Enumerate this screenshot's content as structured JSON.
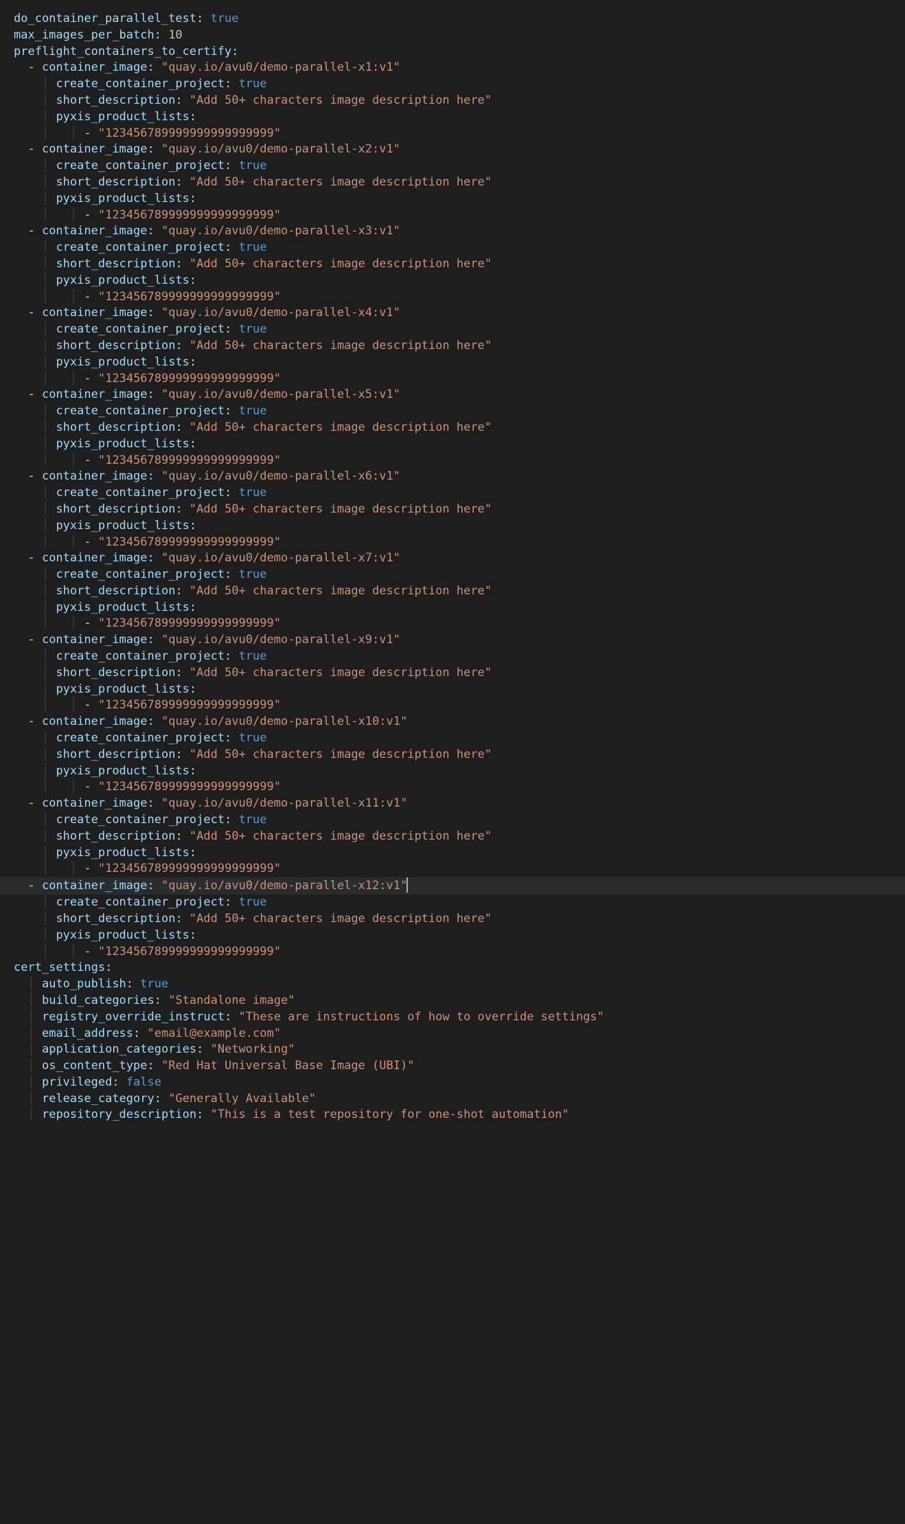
{
  "top": {
    "do_container_parallel_test_key": "do_container_parallel_test",
    "do_container_parallel_test_val": "true",
    "max_images_per_batch_key": "max_images_per_batch",
    "max_images_per_batch_val": "10",
    "preflight_key": "preflight_containers_to_certify"
  },
  "entries": [
    {
      "image": "\"quay.io/avu0/demo-parallel-x1:v1\"",
      "ccp": "true",
      "sd": "\"Add 50+ characters image description here\"",
      "ppl": "\"123456789999999999999999\""
    },
    {
      "image": "\"quay.io/avu0/demo-parallel-x2:v1\"",
      "ccp": "true",
      "sd": "\"Add 50+ characters image description here\"",
      "ppl": "\"123456789999999999999999\""
    },
    {
      "image": "\"quay.io/avu0/demo-parallel-x3:v1\"",
      "ccp": "true",
      "sd": "\"Add 50+ characters image description here\"",
      "ppl": "\"123456789999999999999999\""
    },
    {
      "image": "\"quay.io/avu0/demo-parallel-x4:v1\"",
      "ccp": "true",
      "sd": "\"Add 50+ characters image description here\"",
      "ppl": "\"123456789999999999999999\""
    },
    {
      "image": "\"quay.io/avu0/demo-parallel-x5:v1\"",
      "ccp": "true",
      "sd": "\"Add 50+ characters image description here\"",
      "ppl": "\"123456789999999999999999\""
    },
    {
      "image": "\"quay.io/avu0/demo-parallel-x6:v1\"",
      "ccp": "true",
      "sd": "\"Add 50+ characters image description here\"",
      "ppl": "\"123456789999999999999999\""
    },
    {
      "image": "\"quay.io/avu0/demo-parallel-x7:v1\"",
      "ccp": "true",
      "sd": "\"Add 50+ characters image description here\"",
      "ppl": "\"123456789999999999999999\""
    },
    {
      "image": "\"quay.io/avu0/demo-parallel-x9:v1\"",
      "ccp": "true",
      "sd": "\"Add 50+ characters image description here\"",
      "ppl": "\"123456789999999999999999\""
    },
    {
      "image": "\"quay.io/avu0/demo-parallel-x10:v1\"",
      "ccp": "true",
      "sd": "\"Add 50+ characters image description here\"",
      "ppl": "\"123456789999999999999999\""
    },
    {
      "image": "\"quay.io/avu0/demo-parallel-x11:v1\"",
      "ccp": "true",
      "sd": "\"Add 50+ characters image description here\"",
      "ppl": "\"123456789999999999999999\""
    },
    {
      "image": "\"quay.io/avu0/demo-parallel-x12:v1\"",
      "ccp": "true",
      "sd": "\"Add 50+ characters image description here\"",
      "ppl": "\"123456789999999999999999\""
    }
  ],
  "labels": {
    "container_image": "container_image",
    "create_container_project": "create_container_project",
    "short_description": "short_description",
    "pyxis_product_lists": "pyxis_product_lists"
  },
  "cert_settings_key": "cert_settings",
  "cert_settings": {
    "auto_publish_key": "auto_publish",
    "auto_publish_val": "true",
    "build_categories_key": "build_categories",
    "build_categories_val": "\"Standalone image\"",
    "registry_override_instruct_key": "registry_override_instruct",
    "registry_override_instruct_val": "\"These are instructions of how to override settings\"",
    "email_address_key": "email_address",
    "email_address_val": "\"email@example.com\"",
    "application_categories_key": "application_categories",
    "application_categories_val": "\"Networking\"",
    "os_content_type_key": "os_content_type",
    "os_content_type_val": "\"Red Hat Universal Base Image (UBI)\"",
    "privileged_key": "privileged",
    "privileged_val": "false",
    "release_category_key": "release_category",
    "release_category_val": "\"Generally Available\"",
    "repository_description_key": "repository_description",
    "repository_description_val": "\"This is a test repository for one-shot automation\""
  },
  "highlight_entry_index": 10
}
